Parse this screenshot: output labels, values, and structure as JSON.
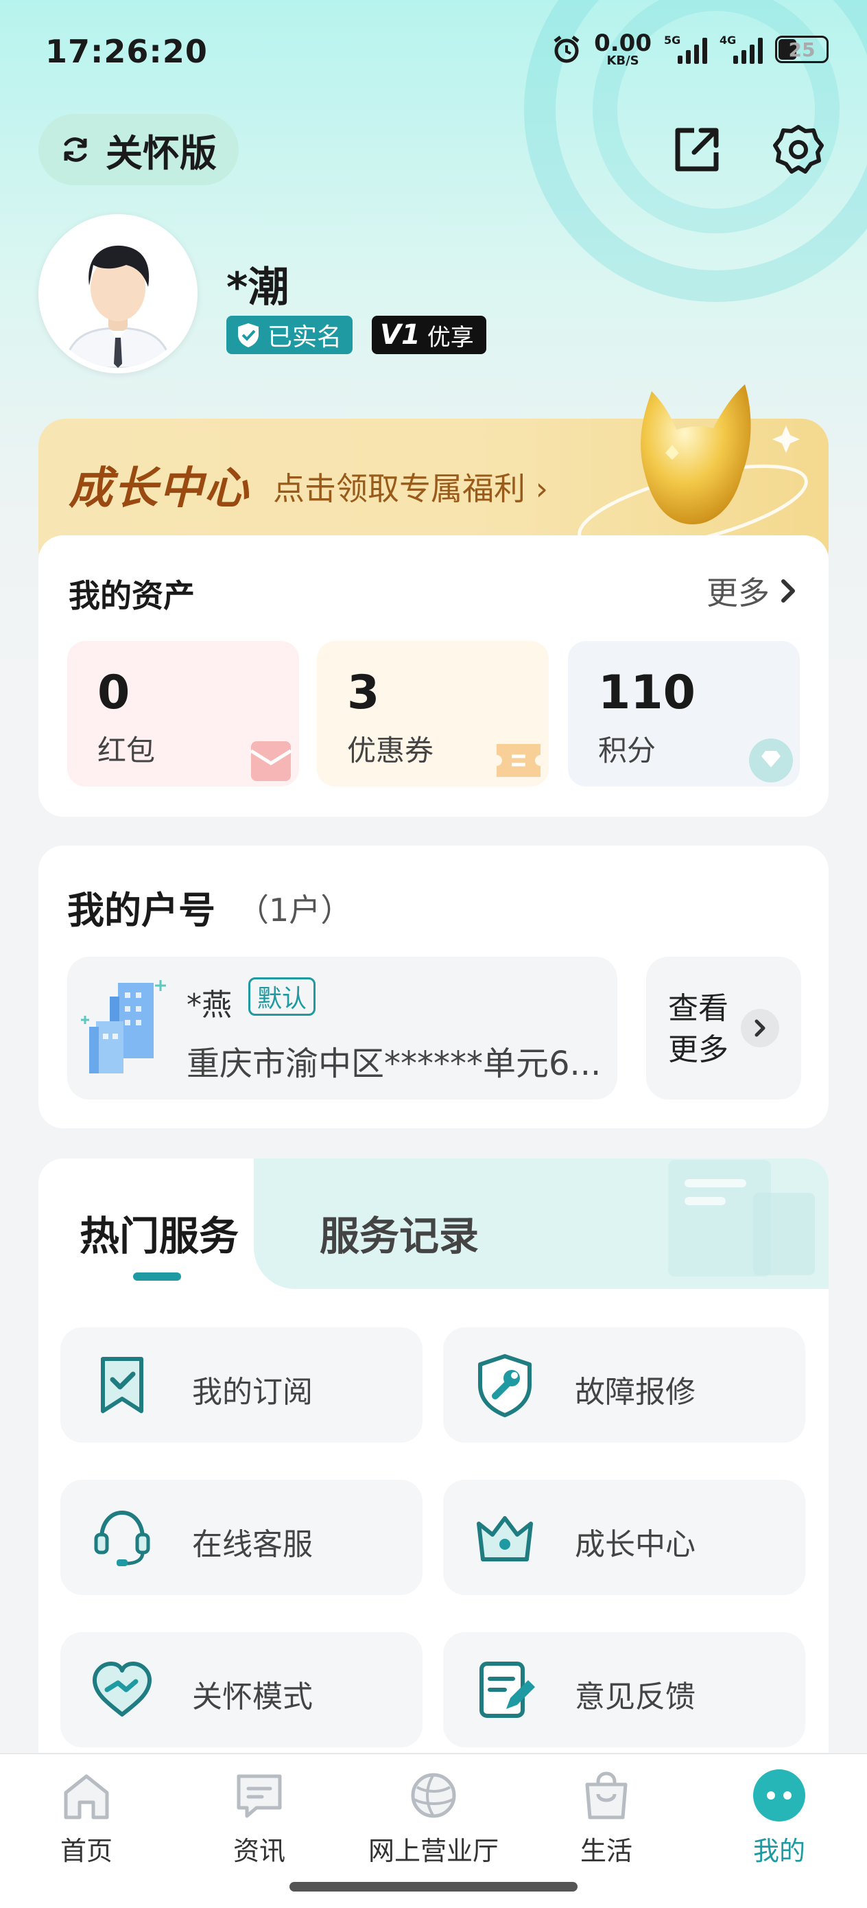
{
  "status_bar": {
    "time": "17:26:20",
    "net_speed_value": "0.00",
    "net_speed_unit": "KB/S",
    "sim1_label": "5G",
    "sim2_label": "4G",
    "battery": "25"
  },
  "header": {
    "care_mode_label": "关怀版",
    "icons": [
      "refresh-icon",
      "share-icon",
      "settings-icon"
    ]
  },
  "profile": {
    "name": "*潮",
    "verified_label": "已实名",
    "vip_level": "V1",
    "vip_label": "优享"
  },
  "growth_banner": {
    "title": "成长中心",
    "subtitle": "点击领取专属福利 ›"
  },
  "assets": {
    "title": "我的资产",
    "more_label": "更多",
    "items": [
      {
        "value": "0",
        "label": "红包",
        "icon": "red-envelope-icon",
        "color": "#fff1f1"
      },
      {
        "value": "3",
        "label": "优惠券",
        "icon": "coupon-icon",
        "color": "#fff7ea"
      },
      {
        "value": "110",
        "label": "积分",
        "icon": "points-icon",
        "color": "#f1f5fa"
      }
    ]
  },
  "account": {
    "title": "我的户号",
    "count": "（1户）",
    "holder": "*燕",
    "default_tag": "默认",
    "address": "重庆市渝中区******单元6...",
    "view_more": "查看更多",
    "view_more_line1": "查看",
    "view_more_line2": "更多"
  },
  "services": {
    "tabs": [
      {
        "label": "热门服务",
        "active": true
      },
      {
        "label": "服务记录",
        "active": false
      }
    ],
    "items": [
      {
        "label": "我的订阅",
        "icon": "subscription-icon"
      },
      {
        "label": "故障报修",
        "icon": "repair-icon"
      },
      {
        "label": "在线客服",
        "icon": "customer-service-icon"
      },
      {
        "label": "成长中心",
        "icon": "crown-icon"
      },
      {
        "label": "关怀模式",
        "icon": "care-heart-icon"
      },
      {
        "label": "意见反馈",
        "icon": "feedback-icon"
      }
    ]
  },
  "bottom_nav": {
    "items": [
      {
        "label": "首页",
        "icon": "home-icon",
        "active": false
      },
      {
        "label": "资讯",
        "icon": "news-icon",
        "active": false
      },
      {
        "label": "网上营业厅",
        "icon": "online-hall-icon",
        "active": false
      },
      {
        "label": "生活",
        "icon": "life-bag-icon",
        "active": false
      },
      {
        "label": "我的",
        "icon": "profile-icon",
        "active": true
      }
    ]
  },
  "colors": {
    "accent": "#1f9aa2",
    "growth_text": "#9a4a10",
    "background": "#f2f4f5"
  }
}
